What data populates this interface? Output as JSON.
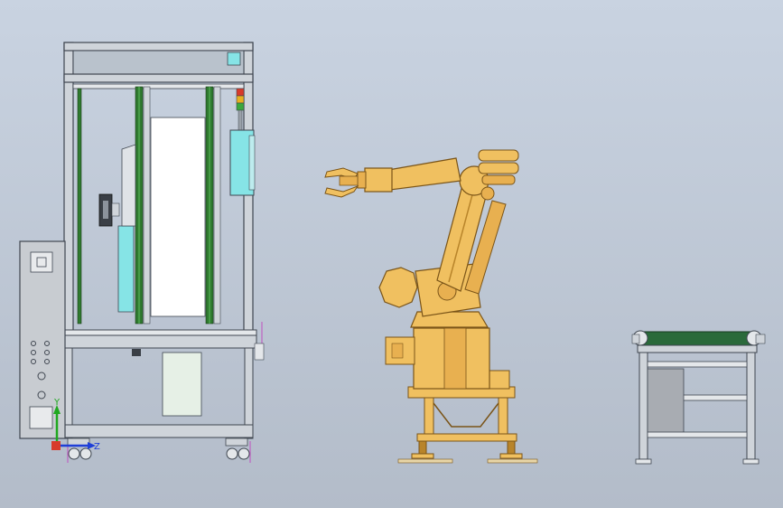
{
  "viewport": {
    "background_top": "#c9d3e1",
    "background_bottom": "#b3bcc9"
  },
  "colors": {
    "frame": "#cfd4da",
    "frame_dark": "#3f4650",
    "frame_light": "#eef0f2",
    "guide_green": "#2f7a2f",
    "cyan_panel": "#86e4e6",
    "robot_yellow": "#f0c060",
    "robot_shade": "#b8842a",
    "robot_dark": "#7a5418",
    "conveyor_green": "#2a6a3a",
    "cabinet_gray": "#a8acb2",
    "signal_red": "#d83a2a",
    "signal_amber": "#e8b020",
    "signal_green": "#3ca83c"
  },
  "triad": {
    "y_label": "Y",
    "z_label": "Z"
  },
  "objects": [
    {
      "name": "enclosed-workstation",
      "parts": [
        "aluminum-frame",
        "linear-guides",
        "white-panel",
        "cyan-side-panel",
        "signal-tower",
        "side-electrical-cabinet",
        "lower-frame",
        "caster-wheels"
      ]
    },
    {
      "name": "industrial-robot-arm",
      "parts": [
        "gripper",
        "forearm",
        "upper-arm",
        "shoulder-motor",
        "turret",
        "base-motor",
        "pedestal",
        "leveling-feet"
      ]
    },
    {
      "name": "roller-conveyor-stand",
      "parts": [
        "green-belt",
        "end-rollers",
        "frame-legs",
        "gray-panel"
      ]
    }
  ]
}
